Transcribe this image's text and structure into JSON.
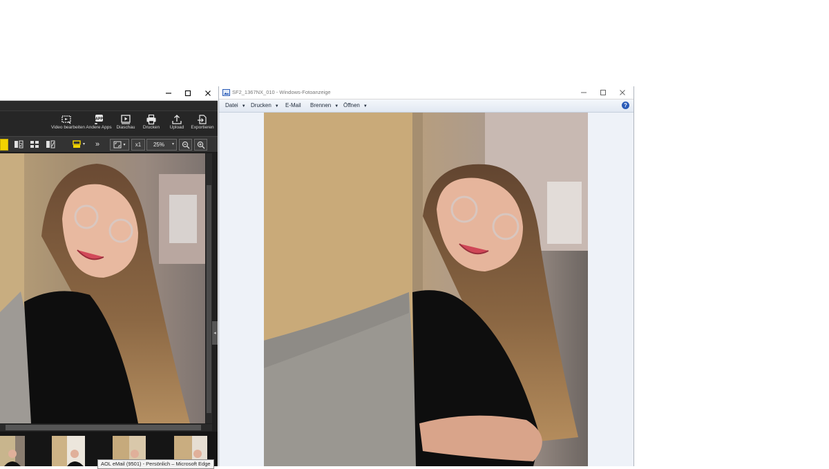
{
  "left_window": {
    "toolbar": [
      {
        "label": "Video bearbeiten",
        "icon": "video-edit-icon"
      },
      {
        "label": "Andere Apps",
        "icon": "apps-icon"
      },
      {
        "label": "Diaschau",
        "icon": "slideshow-icon"
      },
      {
        "label": "Drucken",
        "icon": "printer-icon"
      },
      {
        "label": "Upload",
        "icon": "upload-icon"
      },
      {
        "label": "Exportieren",
        "icon": "export-icon"
      }
    ],
    "tools": {
      "more": "»",
      "multiplier": "x1",
      "zoom_value": "25%",
      "zoom_out_icon": "zoom-out-icon",
      "zoom_in_icon": "zoom-in-icon"
    },
    "accent_color": "#f2d300"
  },
  "right_window": {
    "title": "SF2_1367NX_010 - Windows-Fotoanzeige",
    "menu": [
      {
        "label": "Datei",
        "has_dropdown": true
      },
      {
        "label": "Drucken",
        "has_dropdown": true
      },
      {
        "label": "E-Mail",
        "has_dropdown": false
      },
      {
        "label": "Brennen",
        "has_dropdown": true
      },
      {
        "label": "Öffnen",
        "has_dropdown": true
      }
    ],
    "help": "?"
  },
  "taskbar_tooltip": "AOL eMail (9501) - Persönlich – Microsoft Edge"
}
